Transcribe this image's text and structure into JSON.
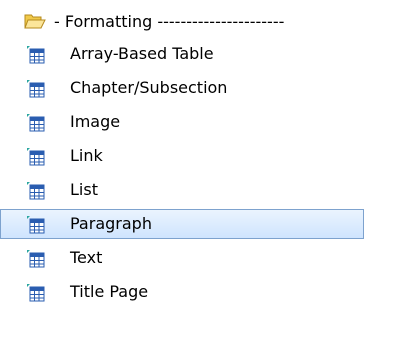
{
  "tree": {
    "folder": {
      "label": "- Formatting ----------------------",
      "icon": "folder-open-icon"
    },
    "items": [
      {
        "label": "Array-Based Table",
        "icon": "table-icon",
        "selected": false
      },
      {
        "label": "Chapter/Subsection",
        "icon": "table-icon",
        "selected": false
      },
      {
        "label": "Image",
        "icon": "table-icon",
        "selected": false
      },
      {
        "label": "Link",
        "icon": "table-icon",
        "selected": false
      },
      {
        "label": "List",
        "icon": "table-icon",
        "selected": false
      },
      {
        "label": "Paragraph",
        "icon": "table-icon",
        "selected": true
      },
      {
        "label": "Text",
        "icon": "table-icon",
        "selected": false
      },
      {
        "label": "Title Page",
        "icon": "table-icon",
        "selected": false
      }
    ],
    "colors": {
      "selection_border": "#7da2ce",
      "selection_fill_top": "#ebf4fe",
      "selection_fill_bottom": "#cfe4fe",
      "folder_yellow": "#f5d76e",
      "icon_blue": "#2a5db0",
      "icon_teal": "#2aa6a0"
    }
  }
}
